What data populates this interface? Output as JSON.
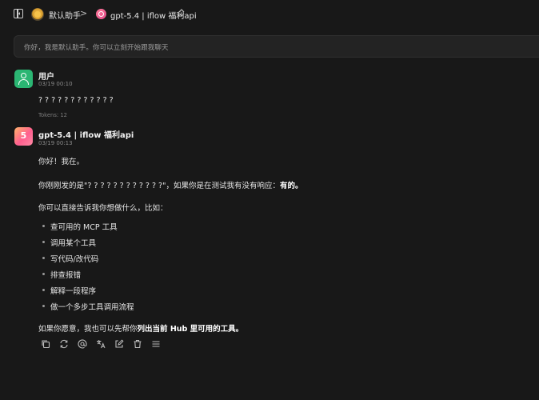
{
  "header": {
    "assistant_name": "默认助手",
    "separator": ">",
    "model_label": "gpt-5.4 | iflow 福利api",
    "chevron": "⌃"
  },
  "prompt_bar": {
    "text": "你好，我是默认助手。你可以立刻开始跟我聊天"
  },
  "user_message": {
    "name": "用户",
    "time": "03/19 00:10",
    "content": "? ? ? ? ? ? ? ? ? ? ? ?",
    "tokens": "Tokens: 12"
  },
  "bot_message": {
    "name": "gpt-5.4 | iflow 福利api",
    "avatar_letter": "5",
    "time": "03/19 00:13",
    "line1": "你好！我在。",
    "line2_pre": "你刚刚发的是\"? ? ? ? ? ? ? ? ? ? ? ?\"，如果你是在测试我有没有响应：",
    "line2_bold": "有的。",
    "line3": "你可以直接告诉我你想做什么，比如：",
    "list": [
      "查可用的 MCP 工具",
      "调用某个工具",
      "写代码/改代码",
      "排查报错",
      "解释一段程序",
      "做一个多步工具调用流程"
    ],
    "line4_pre": "如果你愿意，我也可以先帮你",
    "line4_bold": "列出当前 Hub 里可用的工具。"
  },
  "actions": [
    "copy-icon",
    "regenerate-icon",
    "mention-icon",
    "translate-icon",
    "edit-icon",
    "delete-icon",
    "menu-icon"
  ],
  "colors": {
    "background": "#181818",
    "user_avatar": "#2bb673",
    "bot_avatar": "#ff5f8f"
  }
}
